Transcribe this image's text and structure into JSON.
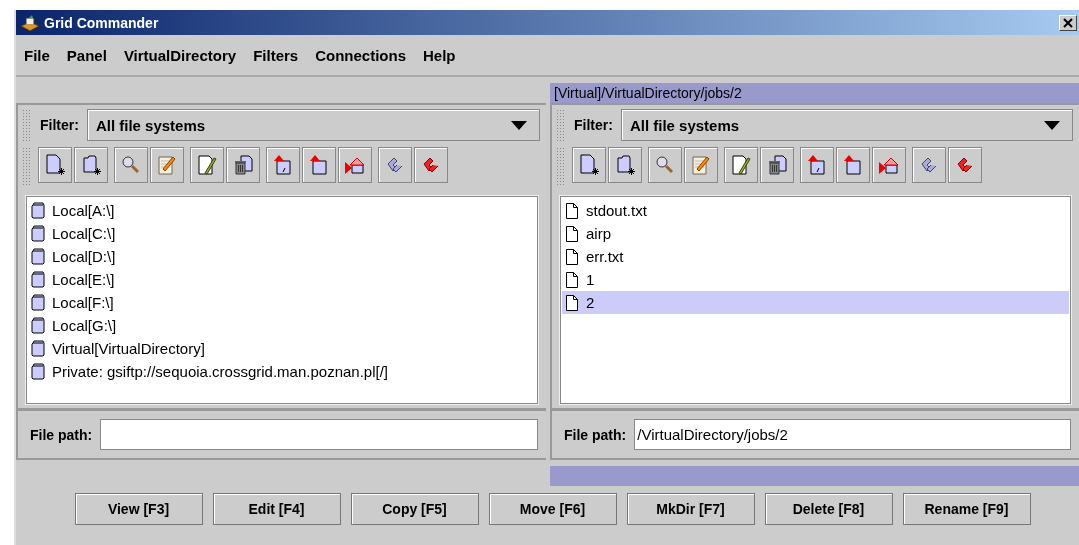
{
  "window": {
    "title": "Grid Commander"
  },
  "menu": [
    "File",
    "Panel",
    "VirtualDirectory",
    "Filters",
    "Connections",
    "Help"
  ],
  "panels": [
    {
      "active": false,
      "filter_label": "Filter:",
      "filter_value": "All file systems",
      "file_path_label": "File path:",
      "items": [
        {
          "kind": "drive",
          "label": "Local[A:\\]",
          "selected": false
        },
        {
          "kind": "drive",
          "label": "Local[C:\\]",
          "selected": false
        },
        {
          "kind": "drive",
          "label": "Local[D:\\]",
          "selected": false
        },
        {
          "kind": "drive",
          "label": "Local[E:\\]",
          "selected": false
        },
        {
          "kind": "drive",
          "label": "Local[F:\\]",
          "selected": false
        },
        {
          "kind": "drive",
          "label": "Local[G:\\]",
          "selected": false
        },
        {
          "kind": "drive",
          "label": "Virtual[VirtualDirectory]",
          "selected": false
        },
        {
          "kind": "drive",
          "label": "Private: gsiftp://sequoia.crossgrid.man.poznan.pl[/]",
          "selected": false
        }
      ]
    },
    {
      "active": true,
      "path": "[Virtual]/VirtualDirectory/jobs/2",
      "filter_label": "Filter:",
      "filter_value": "All file systems",
      "file_path_label": "File path:",
      "file_path": "/VirtualDirectory/jobs/2",
      "items": [
        {
          "kind": "file",
          "label": "stdout.txt",
          "selected": false
        },
        {
          "kind": "file",
          "label": "airp",
          "selected": false
        },
        {
          "kind": "file",
          "label": "err.txt",
          "selected": false
        },
        {
          "kind": "file",
          "label": "1",
          "selected": false
        },
        {
          "kind": "file",
          "label": "2",
          "selected": true
        }
      ]
    }
  ],
  "buttons": [
    "View [F3]",
    "Edit [F4]",
    "Copy [F5]",
    "Move [F6]",
    "MkDir [F7]",
    "Delete [F8]",
    "Rename [F9]"
  ]
}
